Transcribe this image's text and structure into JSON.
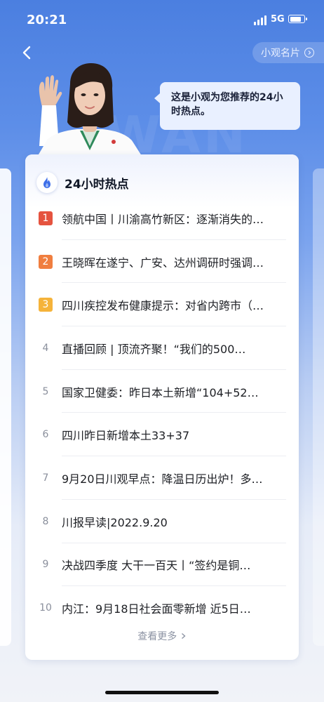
{
  "status_bar": {
    "time": "20:21",
    "network": "5G",
    "signal_bars": 4,
    "battery_level": 0.85
  },
  "header": {
    "back_icon": "chevron-left-icon",
    "card_button_label": "小观名片",
    "card_button_icon": "circle-chevron-right-icon",
    "background_text": "WAN"
  },
  "assistant": {
    "avatar": "virtual-host-avatar",
    "message": "这是小观为您推荐的24小时热点。"
  },
  "hot_list": {
    "icon": "flame-icon",
    "title": "24小时热点",
    "items": [
      {
        "rank": "1",
        "title": "领航中国丨川渝高竹新区：逐渐消失的…",
        "badge_color": "#e5533f"
      },
      {
        "rank": "2",
        "title": "王晓晖在遂宁、广安、达州调研时强调…",
        "badge_color": "#f07e3f"
      },
      {
        "rank": "3",
        "title": "四川疾控发布健康提示：对省内跨市（…",
        "badge_color": "#f5b33a"
      },
      {
        "rank": "4",
        "title": "直播回顾 | 顶流齐聚！“我们的500…"
      },
      {
        "rank": "5",
        "title": "国家卫健委：昨日本土新增“104+52…"
      },
      {
        "rank": "6",
        "title": "四川昨日新增本土33+37"
      },
      {
        "rank": "7",
        "title": "9月20日川观早点：降温日历出炉！多…"
      },
      {
        "rank": "8",
        "title": "川报早读|2022.9.20"
      },
      {
        "rank": "9",
        "title": "决战四季度 大干一百天丨“签约是铜…"
      },
      {
        "rank": "10",
        "title": "内江：9月18日社会面零新增 近5日…"
      }
    ],
    "more_label": "查看更多",
    "more_icon": "chevron-right-icon"
  },
  "colors": {
    "accent": "#4b7fe0",
    "rank_1": "#e5533f",
    "rank_2": "#f07e3f",
    "rank_3": "#f5b33a"
  }
}
